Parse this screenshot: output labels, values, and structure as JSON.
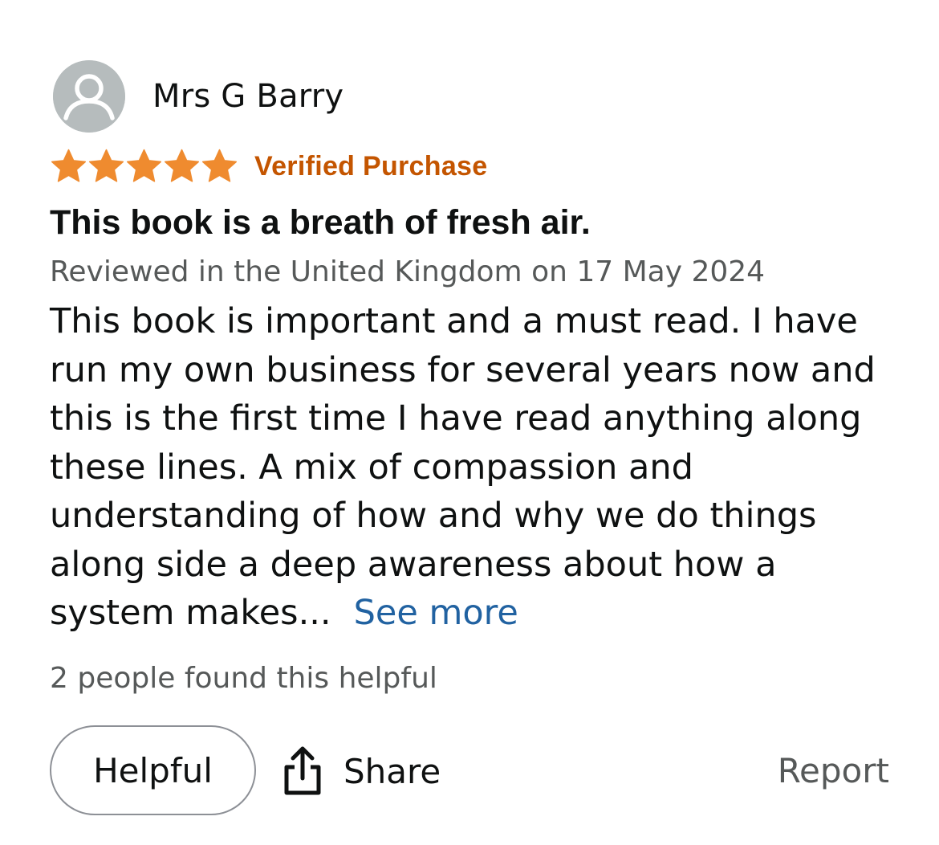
{
  "reviewer": {
    "name": "Mrs G Barry",
    "avatar_icon": "default-user-avatar-icon"
  },
  "rating": {
    "stars": 5,
    "max_stars": 5,
    "star_color": "#ef8b2f",
    "verified_label": "Verified Purchase",
    "verified_color": "#c45500"
  },
  "review": {
    "title": "This book is a breath of fresh air.",
    "date_line": "Reviewed in the United Kingdom on 17 May 2024",
    "body_lines": [
      "This book is important and a must read. I have",
      "run my own business for several years now and",
      "this is the first time I have read anything along",
      "these lines. A mix of compassion and",
      "understanding of how and why we do things",
      "along side a deep awareness about how a",
      "system makes..."
    ],
    "see_more_label": "See more",
    "link_color": "#2162a1"
  },
  "helpful_count_text": "2 people found this helpful",
  "actions": {
    "helpful_label": "Helpful",
    "share_label": "Share",
    "share_icon": "share-upload-icon",
    "report_label": "Report"
  }
}
